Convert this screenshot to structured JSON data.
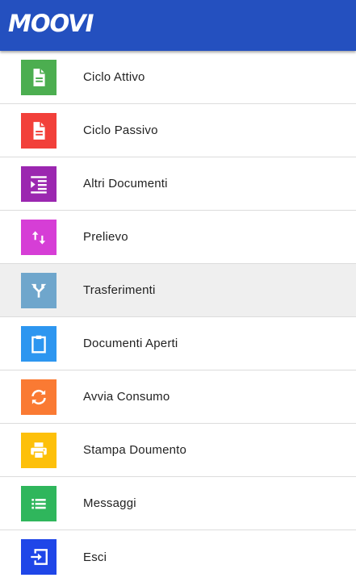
{
  "header": {
    "logo_text": "MOOVI",
    "background": "#2450bf"
  },
  "menu": {
    "items": [
      {
        "label": "Ciclo Attivo",
        "icon": "document-icon",
        "color": "#4cae50"
      },
      {
        "label": "Ciclo Passivo",
        "icon": "document-icon",
        "color": "#f2403a"
      },
      {
        "label": "Altri Documenti",
        "icon": "indent-list-icon",
        "color": "#9b27b0"
      },
      {
        "label": "Prelievo",
        "icon": "swap-vertical-icon",
        "color": "#d63ed6"
      },
      {
        "label": "Trasferimenti",
        "icon": "split-arrows-icon",
        "color": "#6fa6cc",
        "active": true
      },
      {
        "label": "Documenti Aperti",
        "icon": "clipboard-icon",
        "color": "#2d96f0"
      },
      {
        "label": "Avvia Consumo",
        "icon": "sync-icon",
        "color": "#fa7a33"
      },
      {
        "label": "Stampa Doumento",
        "icon": "printer-icon",
        "color": "#fdc00a"
      },
      {
        "label": "Messaggi",
        "icon": "list-icon",
        "color": "#2fb65c"
      },
      {
        "label": "Esci",
        "icon": "sign-out-icon",
        "color": "#1f46e8"
      }
    ]
  }
}
